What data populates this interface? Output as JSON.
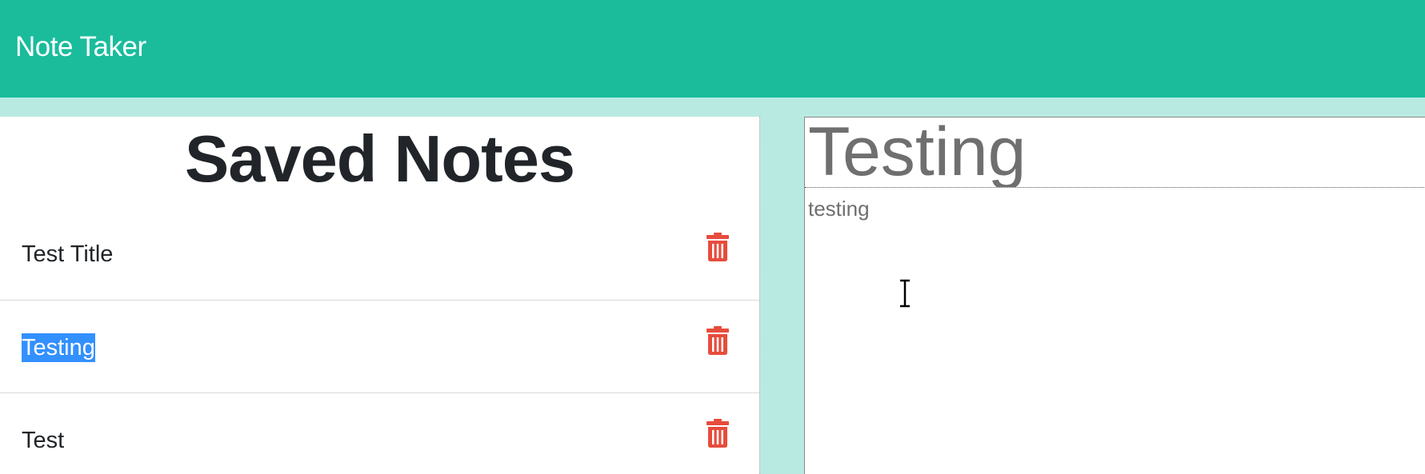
{
  "navbar": {
    "brand": "Note Taker"
  },
  "sidebar": {
    "heading": "Saved Notes",
    "notes": [
      {
        "title": "Test Title",
        "delete_icon": "trash-icon"
      },
      {
        "title": "Testing",
        "delete_icon": "trash-icon",
        "selected": true
      },
      {
        "title": "Test",
        "delete_icon": "trash-icon"
      }
    ]
  },
  "editor": {
    "title_value": "Testing",
    "body_value": "testing"
  },
  "colors": {
    "navbar_bg": "#1abc9c",
    "page_bg": "#b9eae2",
    "trash": "#e74c3c",
    "selection": "#3390ff"
  }
}
